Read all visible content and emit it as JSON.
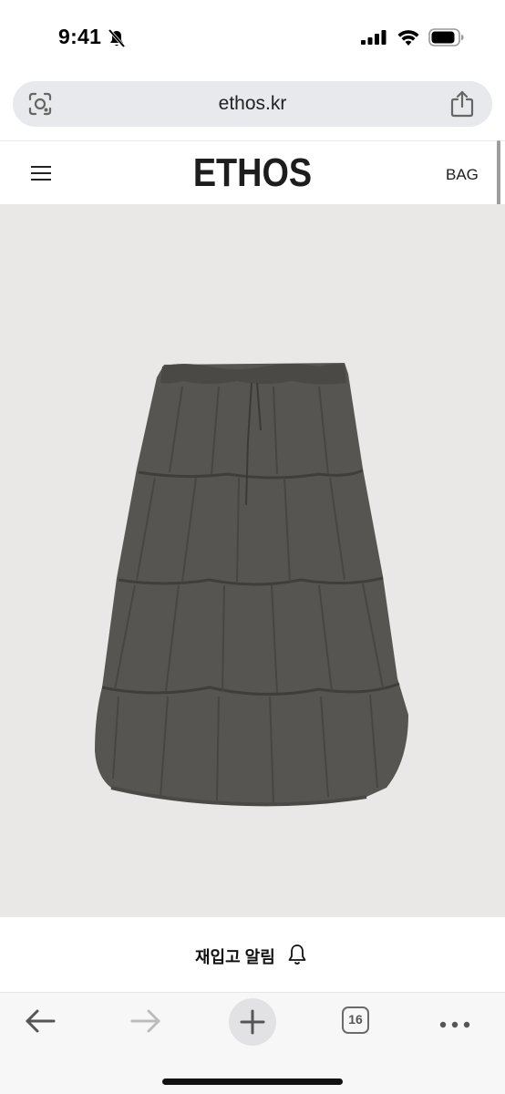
{
  "status_bar": {
    "time": "9:41",
    "icons": [
      "bell-slash-icon",
      "cellular-signal-icon",
      "wifi-icon",
      "battery-icon"
    ]
  },
  "browser": {
    "url": "ethos.kr",
    "open_tabs_count": "16",
    "toolbar_icons": [
      "back-arrow-icon",
      "forward-arrow-icon",
      "plus-icon",
      "tabs-icon",
      "more-icon"
    ]
  },
  "site": {
    "logo": "ETHOS",
    "bag_label": "BAG"
  },
  "product": {
    "image_subject": "gray tiered balloon skirt",
    "restock_alert_label": "재입고 알림"
  },
  "colors": {
    "image_background": "#e9e8e6",
    "skirt": "#545350",
    "url_bar": "#e8e9ec"
  }
}
